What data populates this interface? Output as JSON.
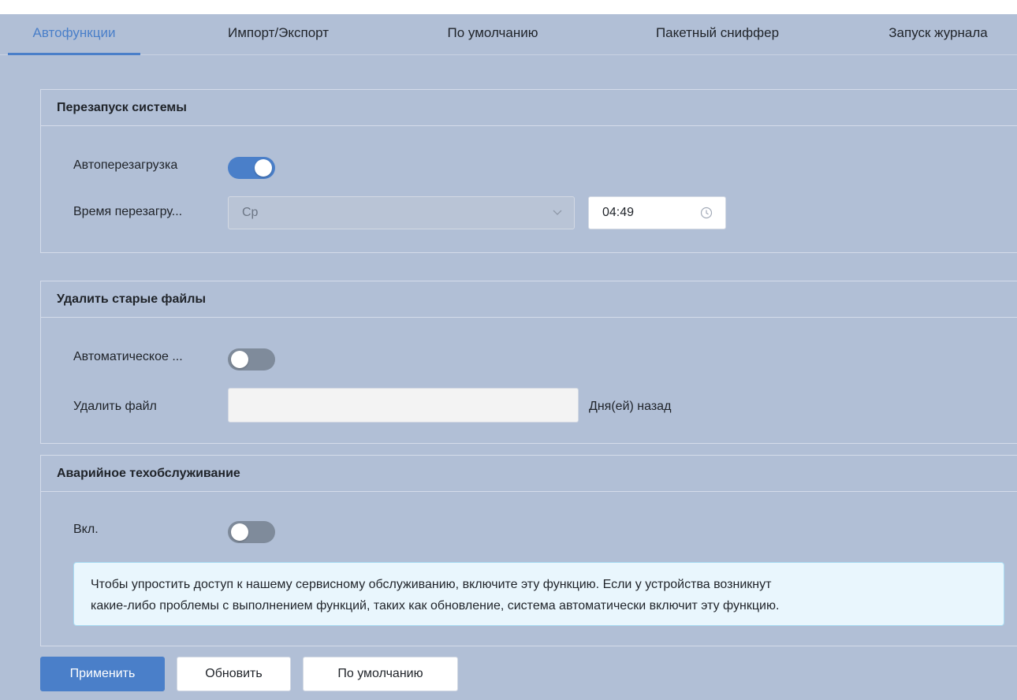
{
  "tabs": [
    {
      "label": "Автофункции",
      "active": true
    },
    {
      "label": "Импорт/Экспорт",
      "active": false
    },
    {
      "label": "По умолчанию",
      "active": false
    },
    {
      "label": "Пакетный сниффер",
      "active": false
    },
    {
      "label": "Запуск журнала",
      "active": false
    }
  ],
  "restart": {
    "title": "Перезапуск системы",
    "auto_reboot_label": "Автоперезагрузка",
    "auto_reboot_on": true,
    "reboot_time_label": "Время перезагру...",
    "day_value": "Ср",
    "time_value": "04:49"
  },
  "delete_old": {
    "title": "Удалить старые файлы",
    "auto_label": "Автоматическое ...",
    "auto_on": false,
    "delete_file_label": "Удалить файл",
    "days_value": "",
    "days_suffix": "Дня(ей) назад"
  },
  "emergency": {
    "title": "Аварийное техобслуживание",
    "enable_label": "Вкл.",
    "enable_on": false,
    "notice_line1": "Чтобы упростить доступ к нашему сервисному обслуживанию, включите эту функцию. Если у устройства возникнут",
    "notice_line2": "какие-либо проблемы с выполнением функций, таких как обновление, система автоматически включит эту функцию."
  },
  "buttons": {
    "apply": "Применить",
    "refresh": "Обновить",
    "default": "По умолчанию"
  },
  "colors": {
    "accent": "#4a7fc9",
    "background": "#b1bfd6",
    "notice_bg": "#e9f6fd"
  },
  "icons": {
    "dropdown": "chevron-down-icon",
    "time": "clock-icon"
  }
}
